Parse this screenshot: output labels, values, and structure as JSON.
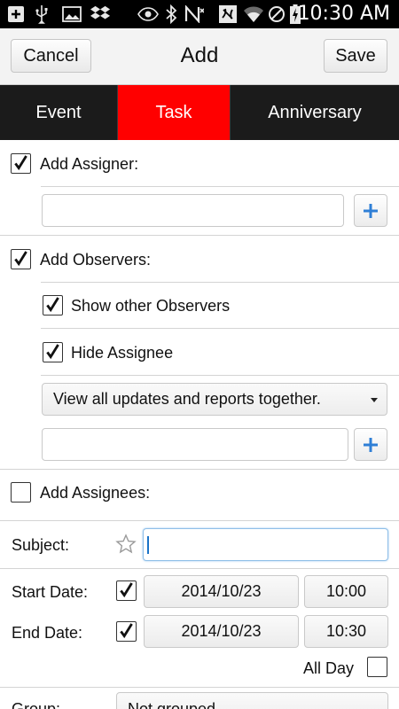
{
  "status_bar": {
    "time": "10:30 AM",
    "icons": [
      "add-box-icon",
      "usb-icon",
      "image-icon",
      "dropbox-icon",
      "eye-icon",
      "bluetooth-icon",
      "no-signal-icon",
      "nfc-icon",
      "wifi-icon",
      "blocked-icon",
      "battery-charging-icon"
    ]
  },
  "action_bar": {
    "cancel_label": "Cancel",
    "title": "Add",
    "save_label": "Save"
  },
  "tabs": [
    {
      "label": "Event",
      "active": false
    },
    {
      "label": "Task",
      "active": true
    },
    {
      "label": "Anniversary",
      "active": false
    }
  ],
  "accent_color": "#ff0000",
  "form": {
    "assigner": {
      "label": "Add Assigner:",
      "checked": true,
      "input_value": ""
    },
    "observers": {
      "label": "Add Observers:",
      "checked": true,
      "show_other_label": "Show other Observers",
      "show_other_checked": true,
      "hide_assignee_label": "Hide Assignee",
      "hide_assignee_checked": true,
      "view_select": "View all updates and reports together.",
      "input_value": ""
    },
    "assignees": {
      "label": "Add Assignees:",
      "checked": false
    },
    "subject": {
      "label": "Subject:",
      "value": ""
    },
    "start": {
      "label": "Start Date:",
      "checked": true,
      "date": "2014/10/23",
      "time": "10:00"
    },
    "end": {
      "label": "End Date:",
      "checked": true,
      "date": "2014/10/23",
      "time": "10:30"
    },
    "all_day": {
      "label": "All Day",
      "checked": false
    },
    "group": {
      "label": "Group:",
      "value": "Not grouped"
    }
  }
}
